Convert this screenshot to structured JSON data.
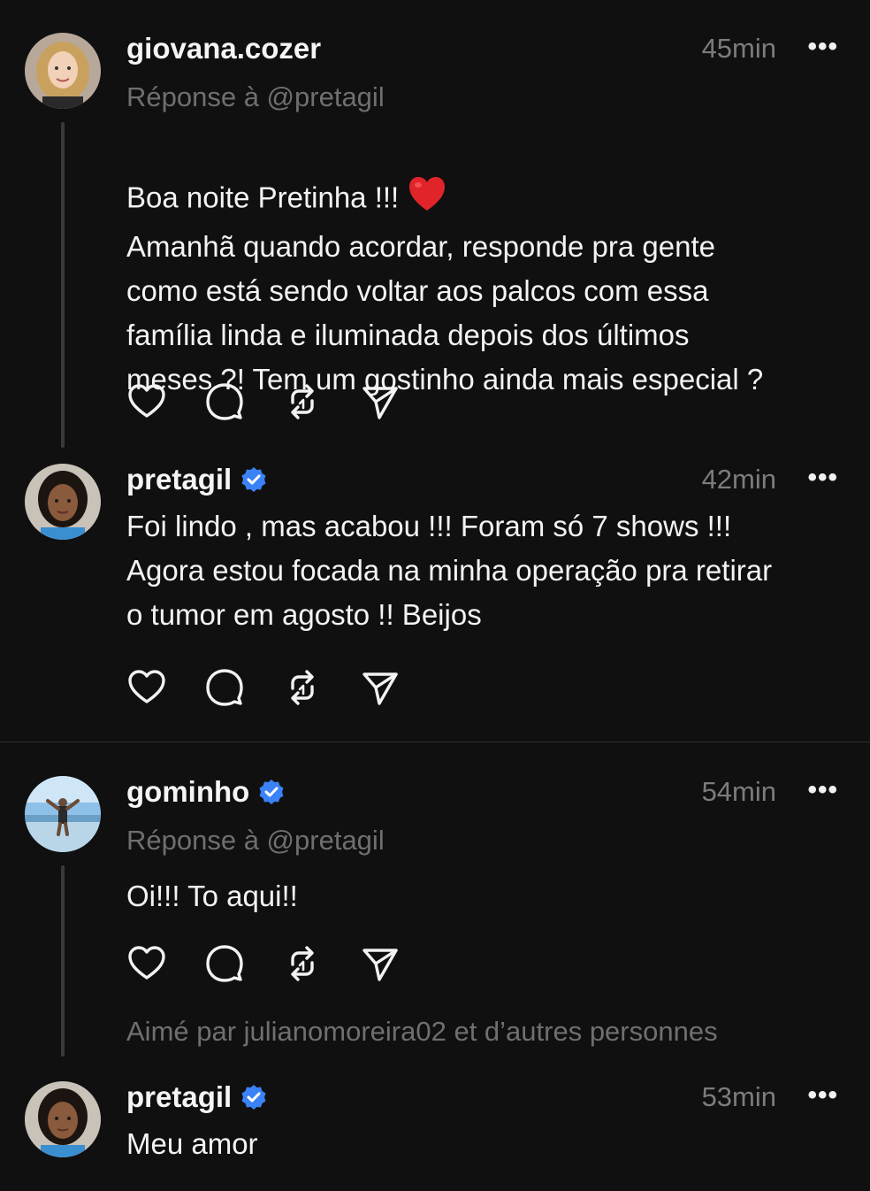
{
  "posts": [
    {
      "username": "giovana.cozer",
      "verified": false,
      "time": "45min",
      "reply_to": "Réponse à @pretagil",
      "text_line1": "Boa noite Pretinha !!!",
      "text_rest": "Amanhã quando acordar, responde pra gente\ncomo está sendo voltar aos palcos com essa\nfamília linda e iluminada depois dos últimos\nmeses ?! Tem um gostinho ainda mais especial ?",
      "emoji": "red-heart-emoji"
    },
    {
      "username": "pretagil",
      "verified": true,
      "time": "42min",
      "text": "Foi lindo , mas acabou !!! Foram só 7 shows !!!\nAgora estou focada na minha operação pra retirar\no tumor em agosto !! Beijos"
    },
    {
      "username": "gominho",
      "verified": true,
      "time": "54min",
      "reply_to": "Réponse à @pretagil",
      "text": "Oi!!! To aqui!!",
      "liked_by": "Aimé par julianomoreira02 et d’autres personnes"
    },
    {
      "username": "pretagil",
      "verified": true,
      "time": "53min",
      "text": "Meu amor"
    }
  ],
  "more_label": "•••",
  "icons": [
    "heart-icon",
    "comment-icon",
    "repost-icon",
    "share-icon",
    "verified-badge-icon",
    "more-icon"
  ],
  "colors": {
    "background": "#101010",
    "text": "#f3f3f3",
    "muted": "#7c7c7c",
    "verified": "#3b82f6",
    "heart": "#e0242a"
  }
}
